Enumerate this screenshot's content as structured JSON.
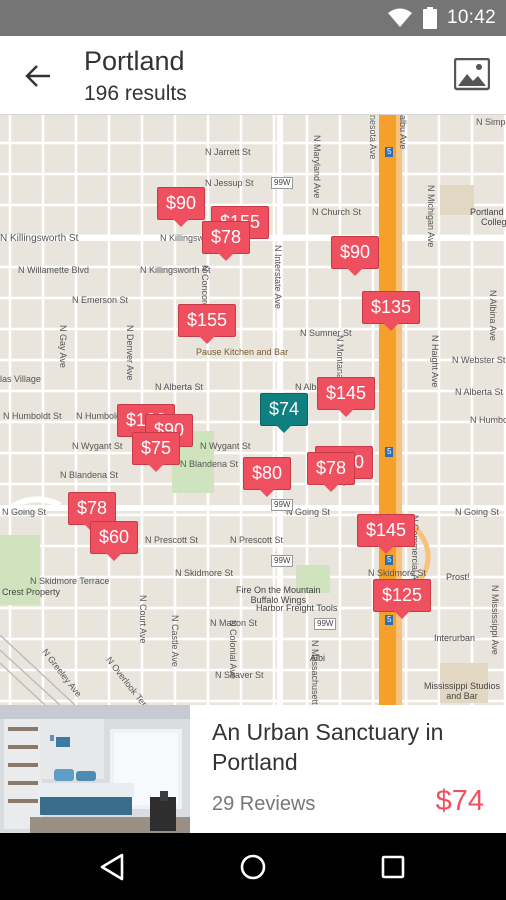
{
  "status_bar": {
    "time": "10:42",
    "icons": [
      "wifi-icon",
      "battery-icon"
    ]
  },
  "header": {
    "title": "Portland",
    "subtitle": "196 results",
    "back_icon": "arrow-left-icon",
    "photo_icon": "image-icon"
  },
  "map": {
    "streets": [
      "N Simpson",
      "N Jarrett St",
      "N Jessup St",
      "N Church St",
      "N Killingsworth St",
      "N Killingsworth St",
      "N Willamette Blvd",
      "N Killingsworth St",
      "N Emerson St",
      "N Sumner St",
      "N Webster St",
      "N Alberta St",
      "N Alberta St",
      "N Alberta St",
      "N Humboldt St",
      "N Humboldt St",
      "N Humboldt",
      "N Wygant St",
      "N Wygant St",
      "N Blandena St",
      "N Blandena St",
      "N Going St",
      "N Going St",
      "N Going St",
      "N Prescott St",
      "N Prescott St",
      "N Skidmore St",
      "N Skidmore Terrace",
      "N Skidmore St",
      "N Mason St",
      "N Shaver St",
      "N Greeley Ave",
      "N Overlook Terrace",
      "N Interstate Ave",
      "N Maryland Ave",
      "N Montana Ave",
      "N Concord Ave",
      "N Denver Ave",
      "N Gay Ave",
      "N Court Ave",
      "N Castle Ave",
      "N Colonial Ave",
      "N Massachusetts",
      "N Michigan Ave",
      "N Albina Ave",
      "N Mississippi Ave",
      "N Commercial Ave",
      "N Haight Ave",
      "nesota Ave",
      "albu Ave",
      "las Village"
    ],
    "pois": [
      "Pause Kitchen and Bar",
      "Fire On the Mountain\nBuffalo Wings",
      "Harbor Freight Tools",
      "Portland Co\nColleg",
      "Mississippi Studios\nand Bar",
      "Crest Property",
      "Albi",
      "Prost!",
      "Interurban"
    ],
    "highways": [
      "99W",
      "99W",
      "99W",
      "99W",
      "5",
      "5",
      "5",
      "5"
    ],
    "markers": [
      {
        "label": "$90",
        "selected": false
      },
      {
        "label": "$155",
        "selected": false
      },
      {
        "label": "$78",
        "selected": false
      },
      {
        "label": "$90",
        "selected": false
      },
      {
        "label": "$135",
        "selected": false
      },
      {
        "label": "$155",
        "selected": false
      },
      {
        "label": "$145",
        "selected": false
      },
      {
        "label": "$74",
        "selected": true
      },
      {
        "label": "$100",
        "selected": false
      },
      {
        "label": "$90",
        "selected": false
      },
      {
        "label": "$75",
        "selected": false
      },
      {
        "label": "$120",
        "selected": false
      },
      {
        "label": "$80",
        "selected": false
      },
      {
        "label": "$78",
        "selected": false
      },
      {
        "label": "$78",
        "selected": false
      },
      {
        "label": "$60",
        "selected": false
      },
      {
        "label": "$145",
        "selected": false
      },
      {
        "label": "$125",
        "selected": false
      }
    ]
  },
  "listing_card": {
    "title": "An Urban Sanctuary in Portland",
    "reviews": "29 Reviews",
    "price": "$74"
  },
  "nav_bar": {
    "icons": [
      "back-triangle-icon",
      "home-circle-icon",
      "recents-square-icon"
    ]
  },
  "colors": {
    "marker": "#ef5060",
    "selected_marker": "#0f7f7f",
    "highway": "#f4a02a",
    "status_bar": "#757575"
  }
}
